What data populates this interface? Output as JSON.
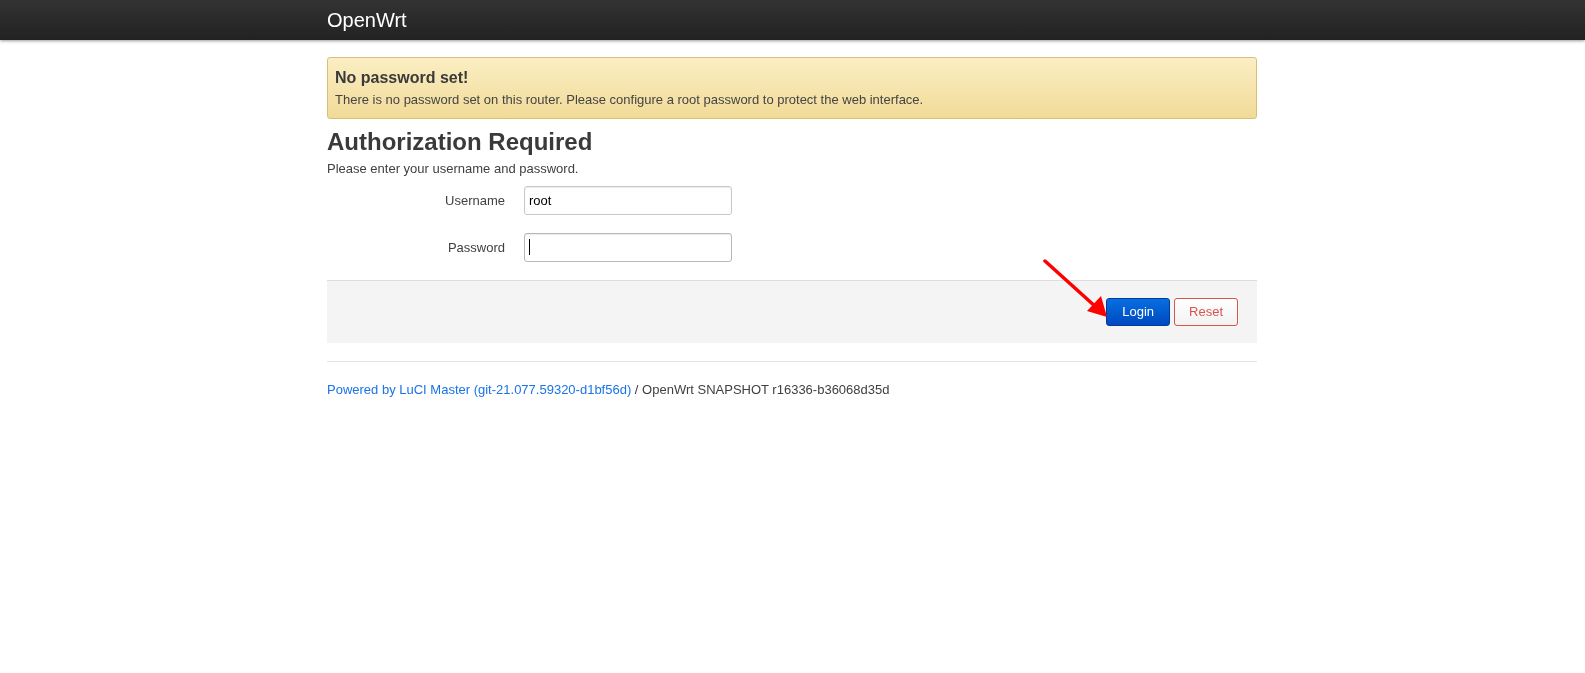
{
  "header": {
    "brand": "OpenWrt"
  },
  "alert": {
    "title": "No password set!",
    "text": "There is no password set on this router. Please configure a root password to protect the web interface."
  },
  "heading": "Authorization Required",
  "intro": "Please enter your username and password.",
  "fields": [
    {
      "label": "Username",
      "value": "root",
      "kind": "text",
      "focused": false
    },
    {
      "label": "Password",
      "kind": "password",
      "focused": true
    }
  ],
  "buttons": [
    {
      "label": "Login",
      "kind": "primary"
    },
    {
      "label": "Reset",
      "kind": "reset"
    }
  ],
  "footer": {
    "link": "Powered by LuCI Master (git-21.077.59320-d1bf56d)",
    "text": " / OpenWrt SNAPSHOT r16336-b36068d35d"
  }
}
